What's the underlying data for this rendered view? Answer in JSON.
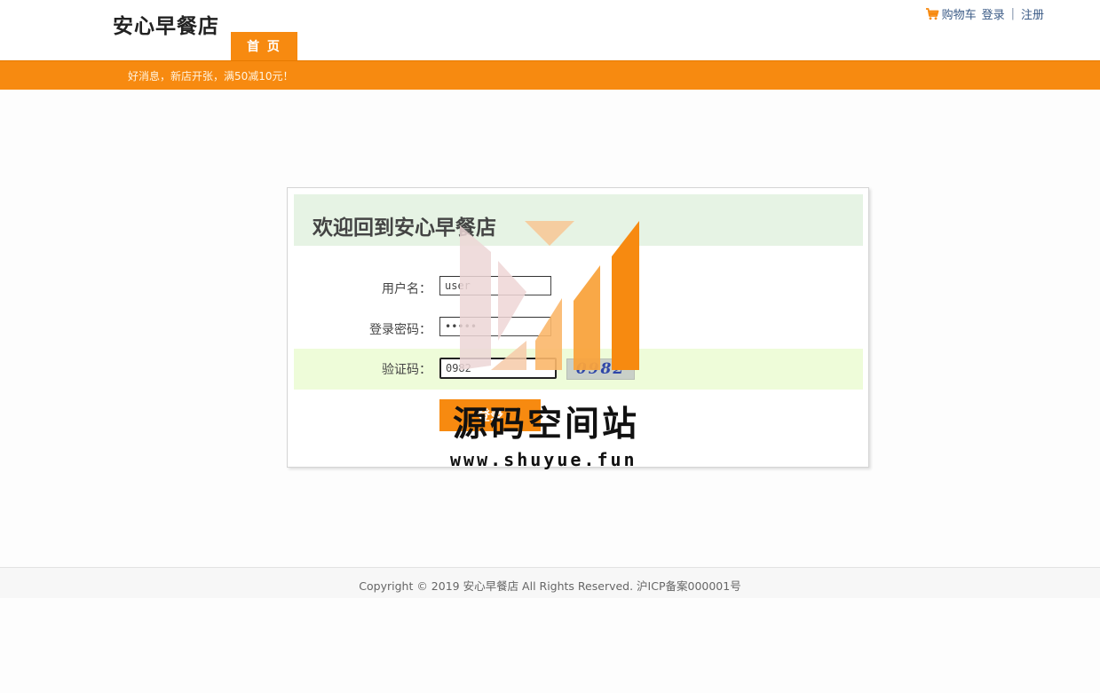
{
  "header": {
    "site_name": "安心早餐店",
    "nav": {
      "home_label": "首 页"
    },
    "links": {
      "cart": "购物车",
      "login": "登录",
      "separator": "|",
      "register": "注册"
    }
  },
  "promo": {
    "text": "好消息，新店开张，满50减10元！"
  },
  "login": {
    "title": "欢迎回到安心早餐店",
    "username_label": "用户名：",
    "username_value": "user",
    "password_label": "登录密码：",
    "password_value": "•••••",
    "captcha_label": "验证码：",
    "captcha_value": "0982",
    "captcha_image_text": "0982",
    "submit_label": "登录"
  },
  "watermark": {
    "title": "源码空间站",
    "url": "www.shuyue.fun"
  },
  "footer": {
    "copyright": "Copyright © 2019 安心早餐店 All Rights Reserved. 沪ICP备案000001号"
  },
  "colors": {
    "accent": "#f78a10",
    "header_band": "#e6f3e4",
    "captcha_band": "#eefcd9"
  }
}
